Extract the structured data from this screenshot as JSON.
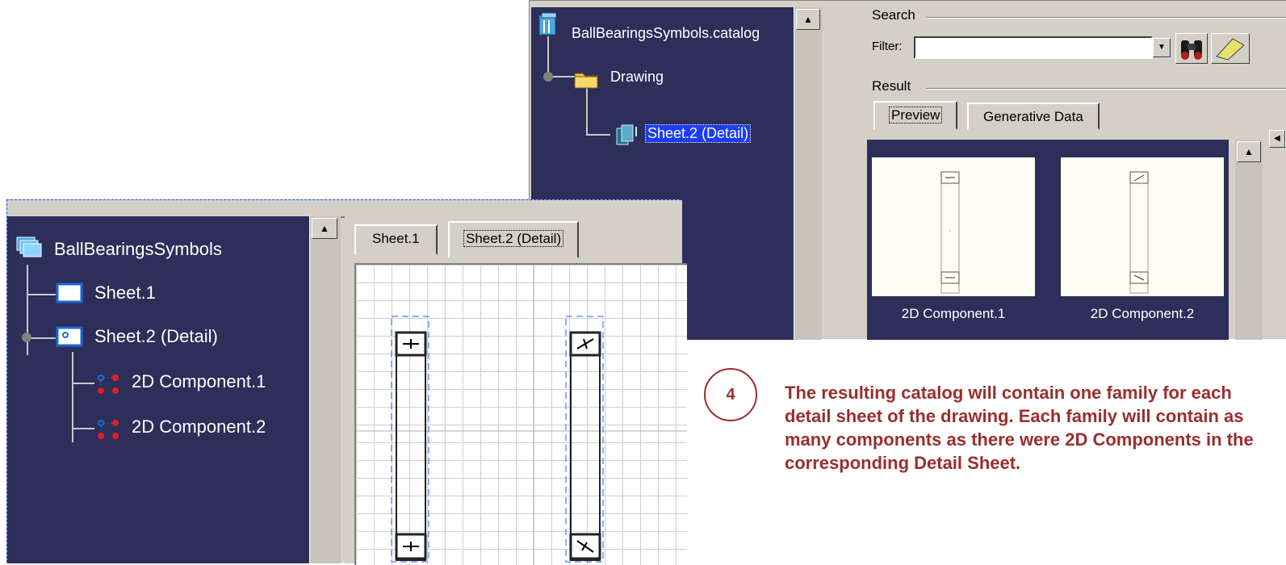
{
  "catalog_tree": {
    "root": "BallBearingsSymbols.catalog",
    "chapter": "Drawing",
    "family": "Sheet.2 (Detail)"
  },
  "search": {
    "section_label": "Search",
    "filter_label": "Filter:",
    "filter_value": "",
    "result_label": "Result",
    "tabs": [
      "Preview",
      "Generative Data"
    ],
    "active_tab": "Preview",
    "results": [
      "2D Component.1",
      "2D Component.2"
    ]
  },
  "drawing_tree": {
    "root": "BallBearingsSymbols",
    "items": [
      "Sheet.1",
      "Sheet.2 (Detail)"
    ],
    "components": [
      "2D Component.1",
      "2D Component.2"
    ]
  },
  "sheet_tabs": [
    "Sheet.1",
    "Sheet.2 (Detail)"
  ],
  "active_sheet": "Sheet.2 (Detail)",
  "step": {
    "number": "4",
    "text": "The resulting catalog will contain one family for each detail sheet of the drawing. Each family will contain as many components as there were 2D Components in the corresponding Detail Sheet."
  },
  "colors": {
    "tree_background": "#2e2e5a",
    "note_text": "#9a2e2e",
    "selection": "#1a3cff"
  }
}
